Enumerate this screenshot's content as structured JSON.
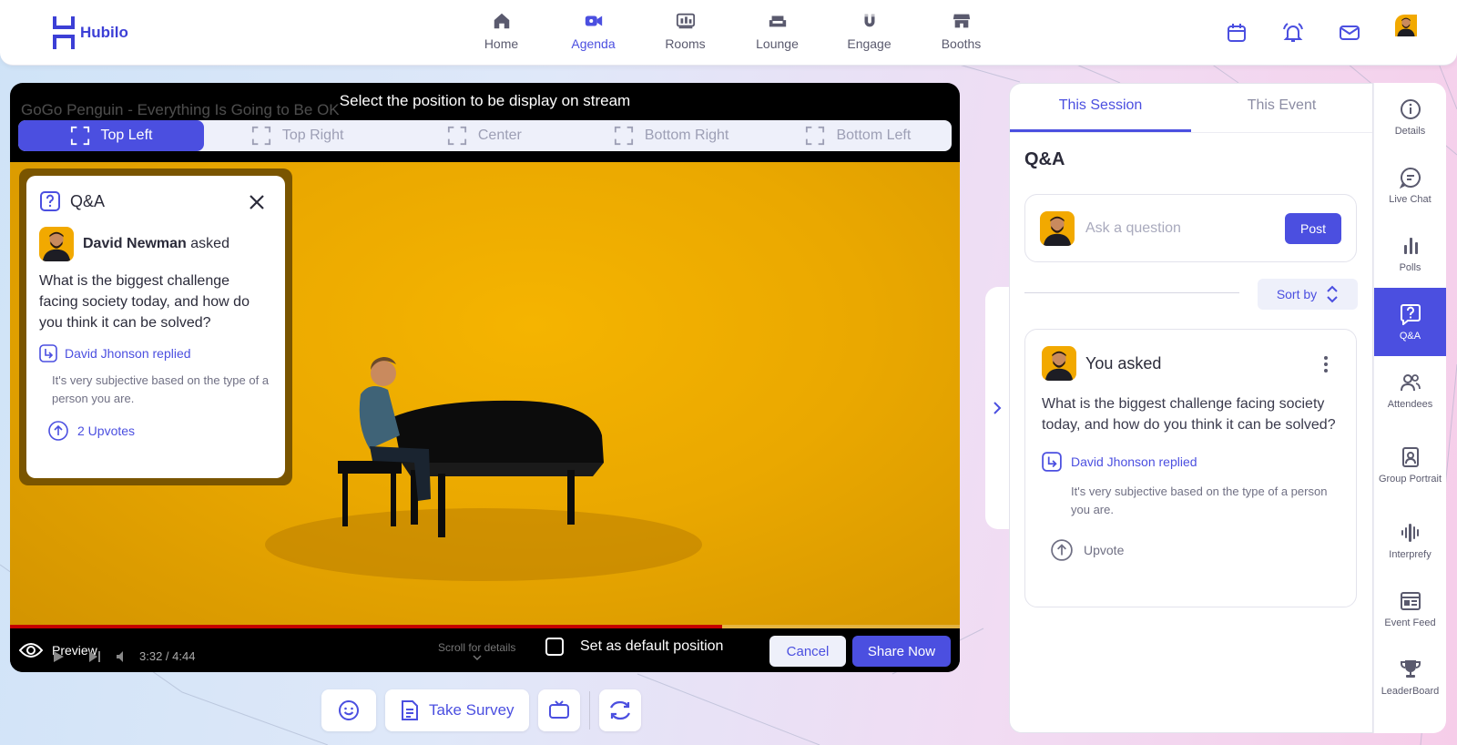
{
  "app": {
    "name": "Hubilo"
  },
  "nav": [
    {
      "label": "Home",
      "icon": "home-icon"
    },
    {
      "label": "Agenda",
      "icon": "video-camera-icon",
      "active": true
    },
    {
      "label": "Rooms",
      "icon": "rooms-icon"
    },
    {
      "label": "Lounge",
      "icon": "sofa-icon"
    },
    {
      "label": "Engage",
      "icon": "magnet-icon"
    },
    {
      "label": "Booths",
      "icon": "store-icon"
    }
  ],
  "video": {
    "youtube_title": "GoGo Penguin - Everything Is Going to Be OK",
    "select_label": "Select the position to be display on stream",
    "positions": [
      "Top Left",
      "Top Right",
      "Center",
      "Bottom Right",
      "Bottom Left"
    ],
    "selected_position": "Top Left",
    "time": "3:32 / 4:44",
    "progress_fraction": 0.75,
    "preview_label": "Preview",
    "scroll_hint": "Scroll for details",
    "default_label": "Set as default position",
    "cancel_label": "Cancel",
    "share_label": "Share Now"
  },
  "overlay_qa": {
    "title": "Q&A",
    "asker_name": "David Newman",
    "asked_suffix": "asked",
    "question": "What is the biggest challenge facing society today, and how do you think it can be solved?",
    "replied_label": "David Jhonson replied",
    "reply": "It's very subjective based on the type of a person you are.",
    "upvotes": "2 Upvotes"
  },
  "tools": {
    "survey_label": "Take Survey"
  },
  "panel": {
    "tabs": [
      "This Session",
      "This Event"
    ],
    "qa_title": "Q&A",
    "ask_placeholder": "Ask a question",
    "post_label": "Post",
    "sort_label": "Sort by",
    "card": {
      "asker": "You asked",
      "question": "What is the biggest challenge facing society today, and how do you think it can be solved?",
      "replied_label": "David Jhonson replied",
      "reply": "It's very subjective based on the type of a person you are.",
      "upvote_label": "Upvote"
    }
  },
  "rail": [
    {
      "label": "Details",
      "icon": "info-icon"
    },
    {
      "label": "Live Chat",
      "icon": "chat-icon"
    },
    {
      "label": "Polls",
      "icon": "bar-chart-icon"
    },
    {
      "label": "Q&A",
      "icon": "question-icon",
      "active": true
    },
    {
      "label": "Attendees",
      "icon": "people-icon"
    },
    {
      "label": "Group Portrait",
      "icon": "portrait-icon"
    },
    {
      "label": "Interprefy",
      "icon": "audio-wave-icon"
    },
    {
      "label": "Event Feed",
      "icon": "feed-icon"
    },
    {
      "label": "LeaderBoard",
      "icon": "trophy-icon"
    }
  ],
  "colors": {
    "accent": "#4b4fe0",
    "stage": "#f2ae00"
  }
}
